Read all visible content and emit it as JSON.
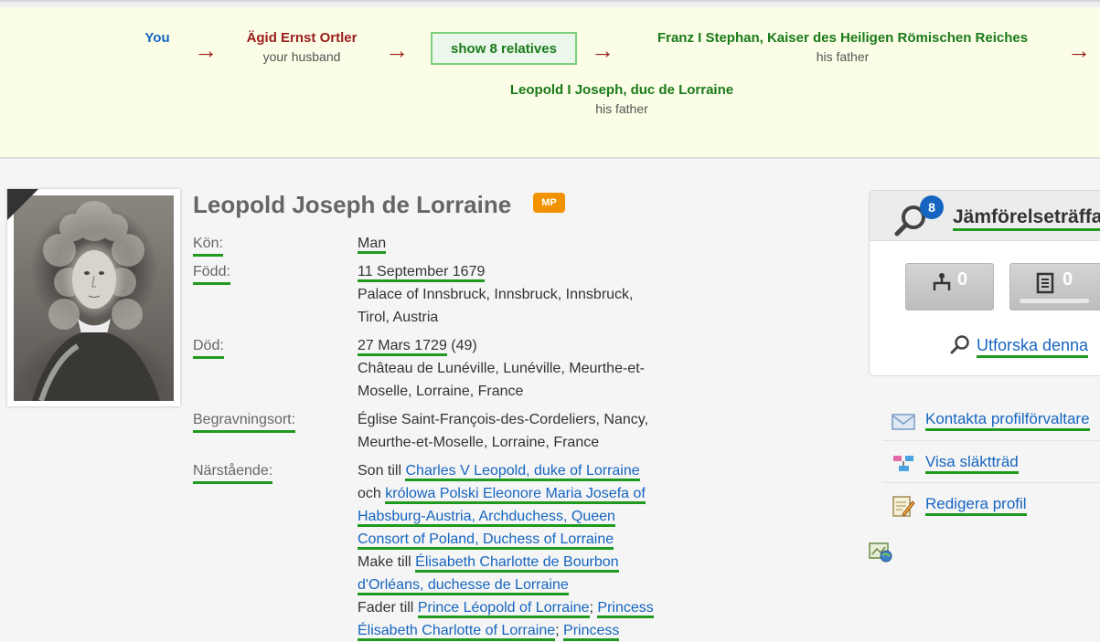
{
  "banner": {
    "you": "You",
    "husband": {
      "name": "Ägid Ernst Ortler",
      "role": "your husband"
    },
    "show_button": "show 8 relatives",
    "father1": {
      "name": "Franz I Stephan, Kaiser des Heiligen Römischen Reiches",
      "role": "his father"
    },
    "father2": {
      "name": "Leopold I Joseph, duc de Lorraine",
      "role": "his father"
    },
    "arrow": "→",
    "colors": {
      "you": "#1565c0",
      "husband": "#9b1c1c",
      "ancestors": "#1a7a1a"
    }
  },
  "profile": {
    "name": "Leopold Joseph de Lorraine",
    "badge": "MP",
    "gender": {
      "label": "Kön:",
      "value": "Man"
    },
    "born": {
      "label": "Född:",
      "date": "11 September 1679",
      "place1": "Palace of Innsbruck, Innsbruck, Innsbruck,",
      "place2": "Tirol, Austria"
    },
    "died": {
      "label": "Död:",
      "date": "27 Mars 1729",
      "age": "(49)",
      "place1": "Château de Lunéville, Lunéville, Meurthe-et-",
      "place2": "Moselle, Lorraine, France"
    },
    "burial": {
      "label": "Begravningsort:",
      "line1": "Église Saint-François-des-Cordeliers, Nancy,",
      "line2": "Meurthe-et-Moselle, Lorraine, France"
    },
    "relatives": {
      "label": "Närstående:",
      "son_of": "Son till",
      "father": "Charles V Leopold, duke of Lorraine",
      "and": "och",
      "mother1": "królowa Polski Eleonore Maria Josefa of",
      "mother2": "Habsburg-Austria, Archduchess, Queen",
      "mother3": "Consort of Poland, Duchess of Lorraine",
      "husband_of": "Make till",
      "wife1": "Élisabeth Charlotte de Bourbon",
      "wife2": "d'Orléans, duchesse de Lorraine",
      "father_of": "Fader till",
      "child1": "Prince Léopold of Lorraine",
      "child_sep": ";",
      "child2": "Princess",
      "child3": "Élisabeth Charlotte of Lorraine",
      "child4": "Princess"
    }
  },
  "sidebar": {
    "match_count": "8",
    "match_title": "Jämförelseträffar",
    "tree_count": "0",
    "record_count": "0",
    "explore": "Utforska denna",
    "actions": [
      {
        "label": "Kontakta profilförvaltare"
      },
      {
        "label": "Visa släktträd"
      },
      {
        "label": "Redigera profil"
      }
    ]
  }
}
